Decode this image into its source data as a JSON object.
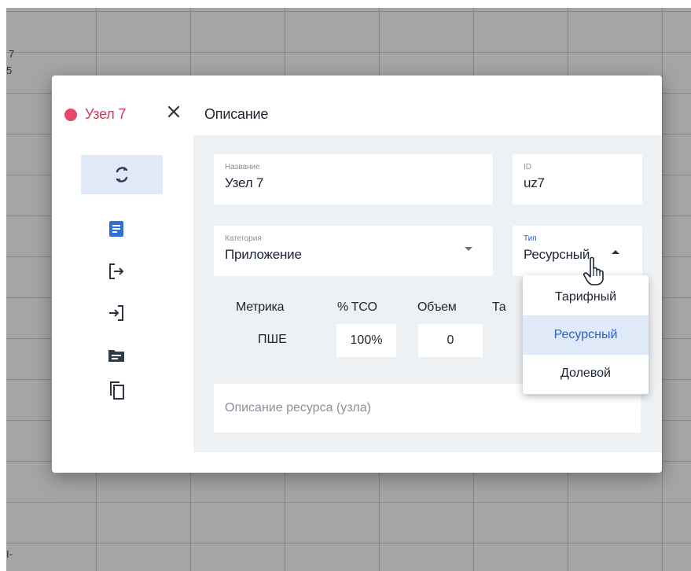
{
  "canvas": {
    "axis_top": [
      "7",
      "5"
    ],
    "axis_bottom": "I-"
  },
  "dialog": {
    "node_name": "Узел 7",
    "close_icon": "close-icon",
    "title": "Описание",
    "dot_color": "#e6486a",
    "accent_color": "#2b63c9"
  },
  "rail": {
    "items": [
      {
        "icon": "sync-icon",
        "active": true
      },
      {
        "icon": "document-icon",
        "active": false
      },
      {
        "icon": "logout-icon",
        "active": false
      },
      {
        "icon": "login-icon",
        "active": false
      },
      {
        "icon": "folder-icon",
        "active": false
      },
      {
        "icon": "copy-icon",
        "active": false
      }
    ]
  },
  "form": {
    "name": {
      "label": "Название",
      "value": "Узел 7"
    },
    "id": {
      "label": "ID",
      "value": "uz7"
    },
    "category": {
      "label": "Категория",
      "value": "Приложение"
    },
    "type": {
      "label": "Тип",
      "value": "Ресурсный"
    },
    "metrics": {
      "headers": [
        "Метрика",
        "% TCO",
        "Объем",
        "Та"
      ],
      "row": {
        "metric": "ПШЕ",
        "tco": "100%",
        "volume": "0"
      }
    },
    "description_placeholder": "Описание ресурса (узла)"
  },
  "type_dropdown": {
    "options": [
      "Тарифный",
      "Ресурсный",
      "Долевой"
    ],
    "selected": "Ресурсный"
  }
}
